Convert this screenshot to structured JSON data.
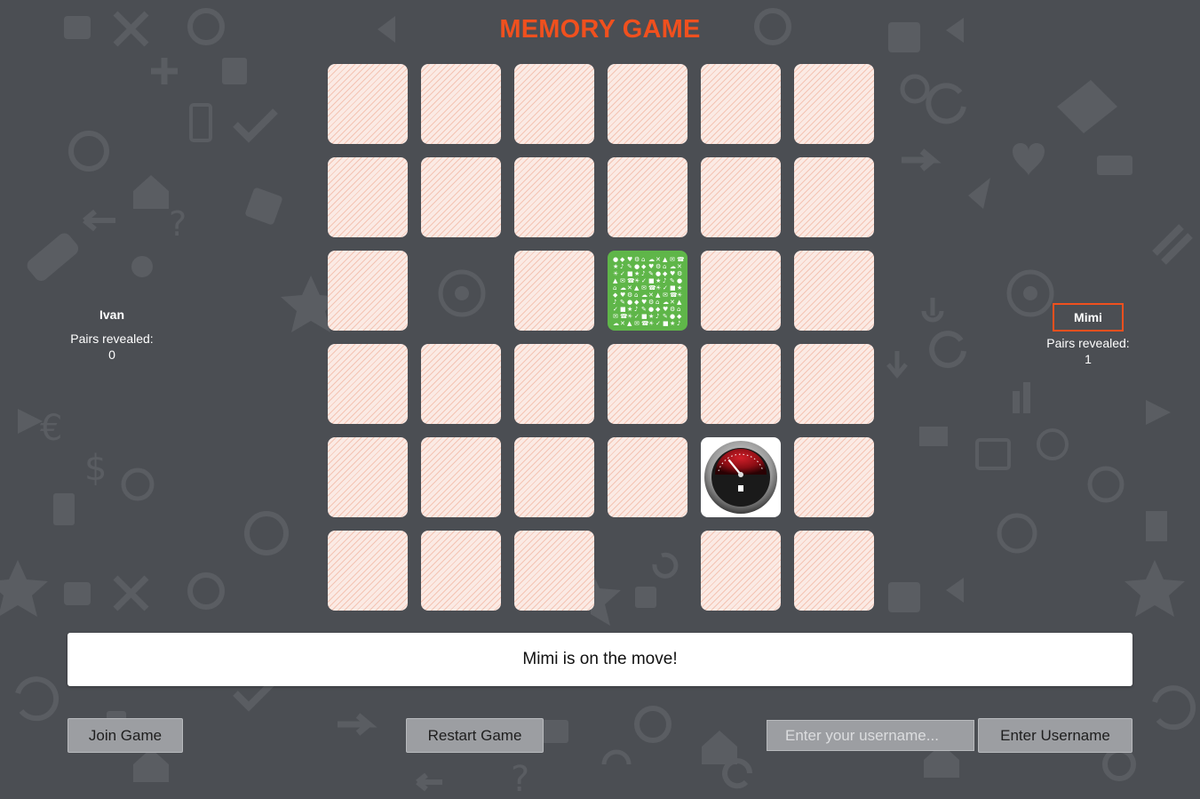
{
  "title": "MEMORY GAME",
  "colors": {
    "accent": "#f0501e",
    "background": "#4b4e53",
    "card_back": "#fbeae4",
    "icons_card": "#5fb649"
  },
  "players": {
    "left": {
      "name": "Ivan",
      "pairs_label": "Pairs revealed: 0",
      "active": false
    },
    "right": {
      "name": "Mimi",
      "pairs_label": "Pairs revealed: 1",
      "active": true
    }
  },
  "board": {
    "rows": 6,
    "cols": 6,
    "cells": [
      [
        "down",
        "down",
        "down",
        "down",
        "down",
        "down"
      ],
      [
        "down",
        "down",
        "down",
        "down",
        "down",
        "down"
      ],
      [
        "down",
        "empty",
        "down",
        "icons-grid",
        "down",
        "down"
      ],
      [
        "down",
        "down",
        "down",
        "down",
        "down",
        "down"
      ],
      [
        "down",
        "down",
        "down",
        "down",
        "fuel-gauge",
        "down"
      ],
      [
        "down",
        "down",
        "down",
        "empty",
        "down",
        "down"
      ]
    ]
  },
  "status_message": "Mimi is on the move!",
  "controls": {
    "join_label": "Join Game",
    "restart_label": "Restart Game",
    "username_placeholder": "Enter your username...",
    "username_value": "",
    "enter_username_label": "Enter Username"
  }
}
